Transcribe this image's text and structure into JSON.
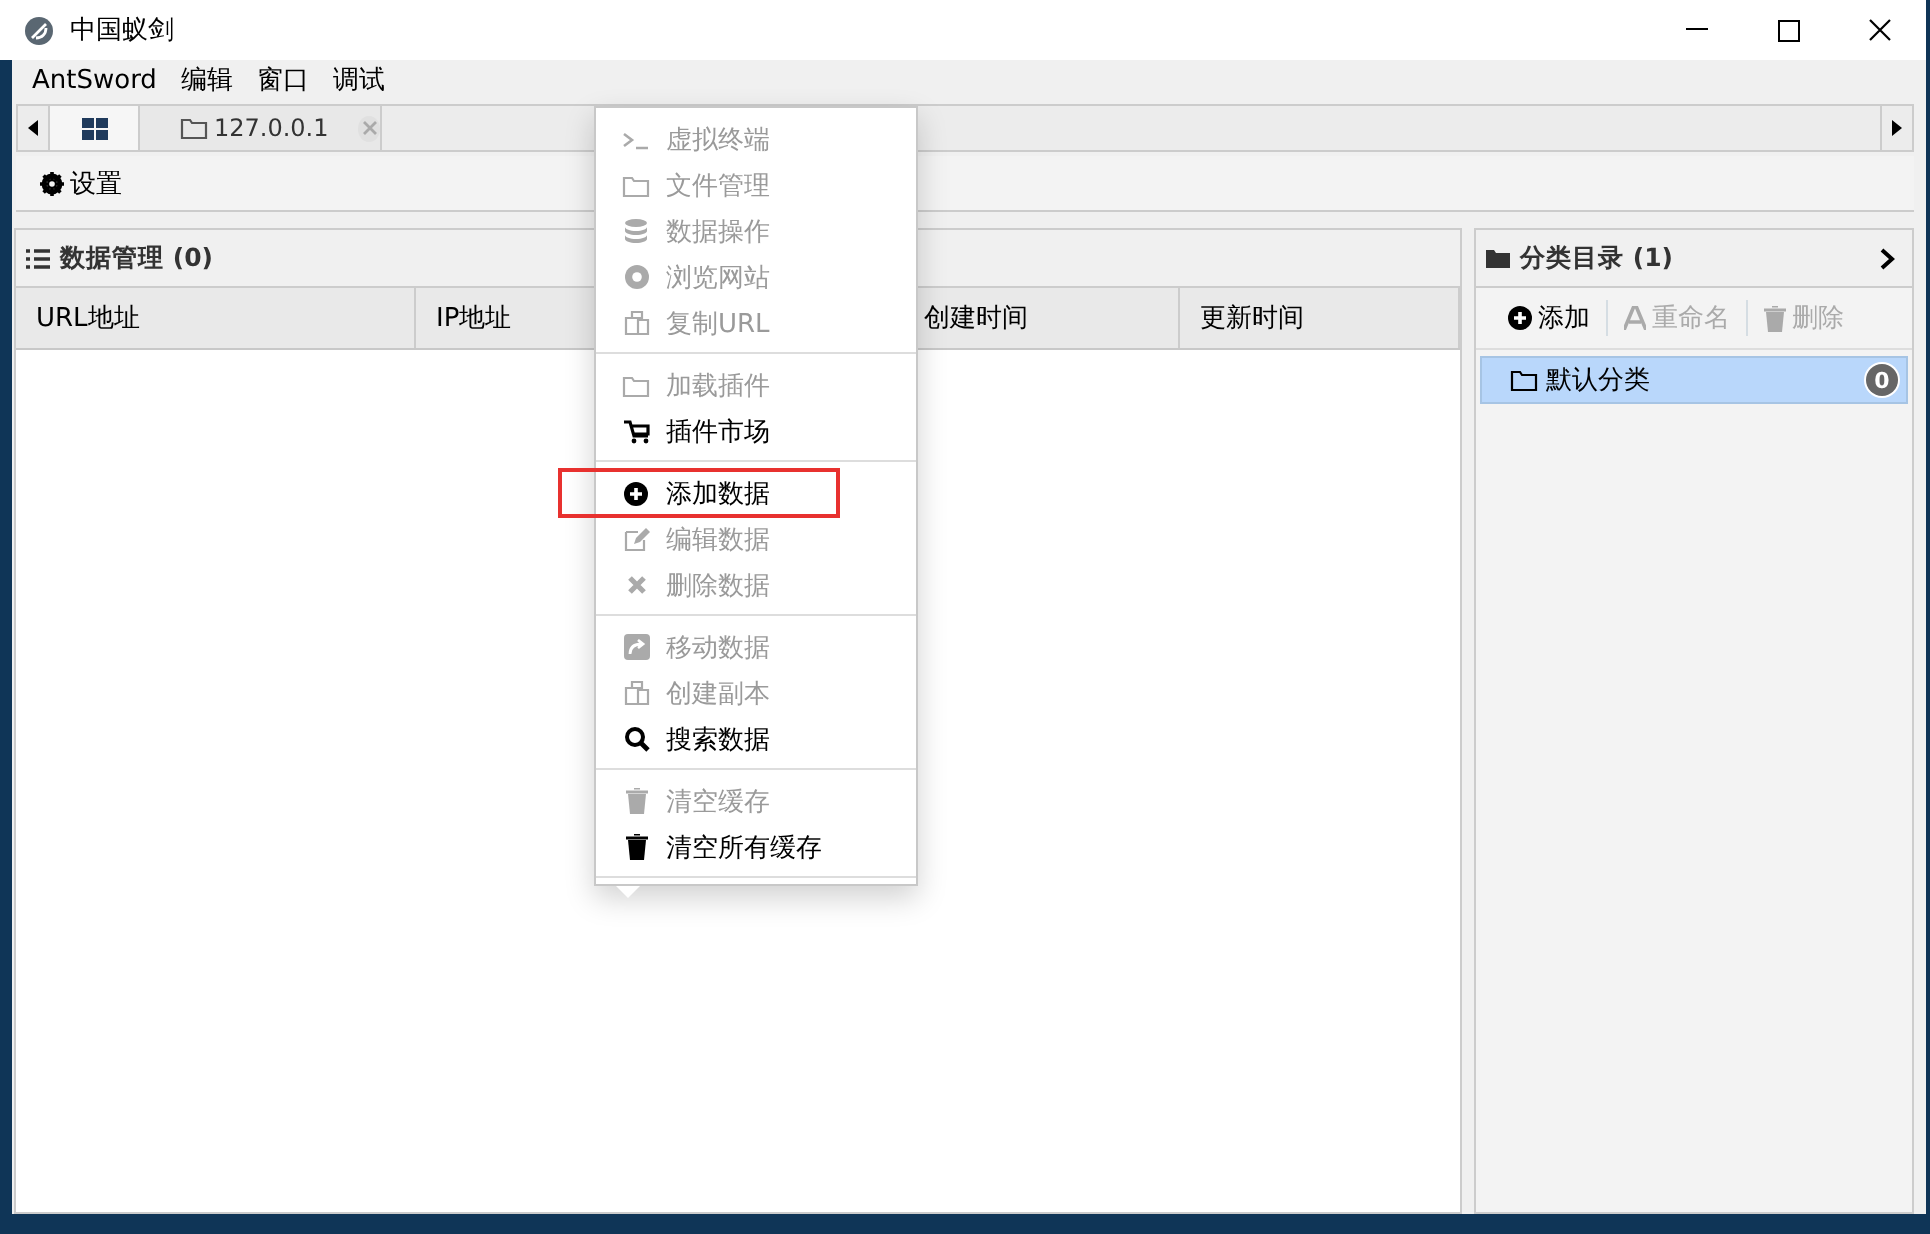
{
  "window": {
    "title": "中国蚁剑"
  },
  "menu_bar": [
    "AntSword",
    "编辑",
    "窗口",
    "调试"
  ],
  "tabs": [
    {
      "selected": true
    },
    {
      "label": "127.0.0.1",
      "selected": false
    }
  ],
  "toolbar": {
    "settings": "设置"
  },
  "data_panel": {
    "title": "数据管理 (0)",
    "columns": [
      "URL地址",
      "IP地址",
      "创建时间",
      "更新时间"
    ]
  },
  "category_panel": {
    "title": "分类目录 (1)",
    "buttons": [
      {
        "label": "添加",
        "disabled": false
      },
      {
        "label": "重命名",
        "disabled": true
      },
      {
        "label": "删除",
        "disabled": true
      }
    ],
    "items": [
      {
        "label": "默认分类",
        "count": "0",
        "selected": true
      }
    ]
  },
  "context_menu": {
    "groups": [
      [
        {
          "label": "虚拟终端",
          "disabled": true
        },
        {
          "label": "文件管理",
          "disabled": true
        },
        {
          "label": "数据操作",
          "disabled": true
        },
        {
          "label": "浏览网站",
          "disabled": true
        },
        {
          "label": "复制URL",
          "disabled": true
        }
      ],
      [
        {
          "label": "加载插件",
          "disabled": true
        },
        {
          "label": "插件市场",
          "disabled": false
        }
      ],
      [
        {
          "label": "添加数据",
          "disabled": false,
          "highlighted": true
        },
        {
          "label": "编辑数据",
          "disabled": true
        },
        {
          "label": "删除数据",
          "disabled": true
        }
      ],
      [
        {
          "label": "移动数据",
          "disabled": true
        },
        {
          "label": "创建副本",
          "disabled": true
        },
        {
          "label": "搜索数据",
          "disabled": false
        }
      ],
      [
        {
          "label": "清空缓存",
          "disabled": true
        },
        {
          "label": "清空所有缓存",
          "disabled": false
        }
      ]
    ]
  }
}
